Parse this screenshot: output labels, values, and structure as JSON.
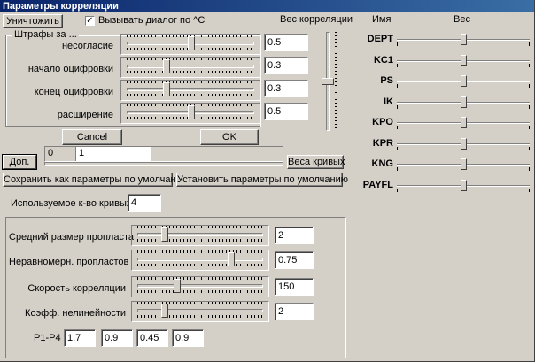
{
  "window": {
    "title": "Параметры корреляции"
  },
  "top": {
    "destroy_label": "Уничтожить",
    "call_dialog_label": "Вызывать диалог по ^C",
    "call_dialog_checked": true,
    "weight_label": "Вес корреляции"
  },
  "penalties": {
    "group_title": "Штрафы за ...",
    "rows": [
      {
        "label": "несогласие",
        "value": "0.5",
        "fraction": 0.5
      },
      {
        "label": "начало оцифровки",
        "value": "0.3",
        "fraction": 0.3
      },
      {
        "label": "конец оцифровки",
        "value": "0.3",
        "fraction": 0.3
      },
      {
        "label": "расширение",
        "value": "0.5",
        "fraction": 0.5
      }
    ],
    "correlation_weight_fraction": 0.5
  },
  "buttons": {
    "cancel": "Cancel",
    "ok": "OK",
    "more": "Доп.",
    "curve_weights": "Веса кривых",
    "save_defaults": "Сохранить как параметры по умолчанию",
    "set_defaults": "Установить параметры по умолчанию"
  },
  "range": {
    "start": "0",
    "end": "1"
  },
  "curves_count": {
    "label": "Используемое к-во кривых",
    "value": "4"
  },
  "params": {
    "rows": [
      {
        "label": "Средний размер пропласта",
        "value": "2",
        "fraction": 0.2
      },
      {
        "label": "Неравномерн. пропластов",
        "value": "0.75",
        "fraction": 0.75
      },
      {
        "label": "Скорость корреляции",
        "value": "150",
        "fraction": 0.3
      },
      {
        "label": "Коэфф. нелинейности",
        "value": "2",
        "fraction": 0.2
      }
    ],
    "p_label": "P1-P4",
    "p_values": [
      "1.7",
      "0.9",
      "0.45",
      "0.9"
    ]
  },
  "curves": {
    "name_header": "Имя",
    "weight_header": "Вес",
    "items": [
      {
        "name": "DEPT",
        "weight": 0.5
      },
      {
        "name": "KC1",
        "weight": 0.5
      },
      {
        "name": "PS",
        "weight": 0.5
      },
      {
        "name": "IK",
        "weight": 0.5
      },
      {
        "name": "KPO",
        "weight": 0.5
      },
      {
        "name": "KPR",
        "weight": 0.5
      },
      {
        "name": "KNG",
        "weight": 0.5
      },
      {
        "name": "PAYFL",
        "weight": 0.5
      }
    ]
  },
  "icons": {
    "checkbox": "check-icon"
  }
}
